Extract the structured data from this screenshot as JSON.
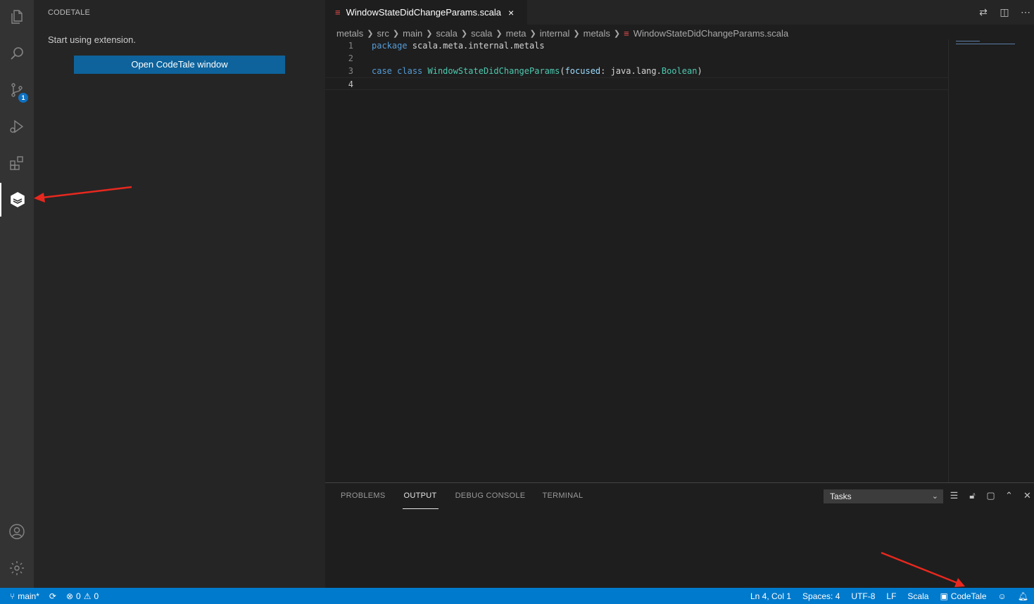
{
  "activity_bar": {
    "items": [
      "explorer-icon",
      "search-icon",
      "source-control-icon",
      "run-debug-icon",
      "extensions-icon",
      "codetale-icon"
    ],
    "source_control_badge": "1",
    "bottom_items": [
      "accounts-icon",
      "settings-gear-icon"
    ]
  },
  "sidebar": {
    "title": "CODETALE",
    "message": "Start using extension.",
    "open_button": "Open CodeTale window"
  },
  "editor": {
    "tab": {
      "label": "WindowStateDidChangeParams.scala",
      "icon": "scala-file-icon",
      "close": "×"
    },
    "breadcrumb": [
      "metals",
      "src",
      "main",
      "scala",
      "scala",
      "meta",
      "internal",
      "metals",
      "WindowStateDidChangeParams.scala"
    ],
    "lines": [
      {
        "num": "1",
        "tokens": [
          {
            "t": "package",
            "c": "kw"
          },
          {
            "t": " scala.meta.internal.metals",
            "c": "pl"
          }
        ]
      },
      {
        "num": "2",
        "tokens": []
      },
      {
        "num": "3",
        "tokens": [
          {
            "t": "case",
            "c": "kw"
          },
          {
            "t": " ",
            "c": "pl"
          },
          {
            "t": "class",
            "c": "kw"
          },
          {
            "t": " ",
            "c": "pl"
          },
          {
            "t": "WindowStateDidChangeParams",
            "c": "ty"
          },
          {
            "t": "(",
            "c": "pl"
          },
          {
            "t": "focused",
            "c": "pm"
          },
          {
            "t": ": java.lang.",
            "c": "pl"
          },
          {
            "t": "Boolean",
            "c": "ty"
          },
          {
            "t": ")",
            "c": "pl"
          }
        ]
      },
      {
        "num": "4",
        "tokens": []
      }
    ],
    "current_line": "4"
  },
  "panel": {
    "tabs": [
      {
        "label": "PROBLEMS",
        "active": false
      },
      {
        "label": "OUTPUT",
        "active": true
      },
      {
        "label": "DEBUG CONSOLE",
        "active": false
      },
      {
        "label": "TERMINAL",
        "active": false
      }
    ],
    "select_value": "Tasks"
  },
  "status_bar": {
    "branch": "main*",
    "errors": "0",
    "warnings": "0",
    "position": "Ln 4, Col 1",
    "spaces": "Spaces: 4",
    "encoding": "UTF-8",
    "eol": "LF",
    "language": "Scala",
    "codetale": "CodeTale"
  },
  "colors": {
    "accent": "#007acc",
    "button": "#0e639c",
    "annotation_arrow": "#e8281e",
    "scala_icon": "#e34c4c"
  }
}
